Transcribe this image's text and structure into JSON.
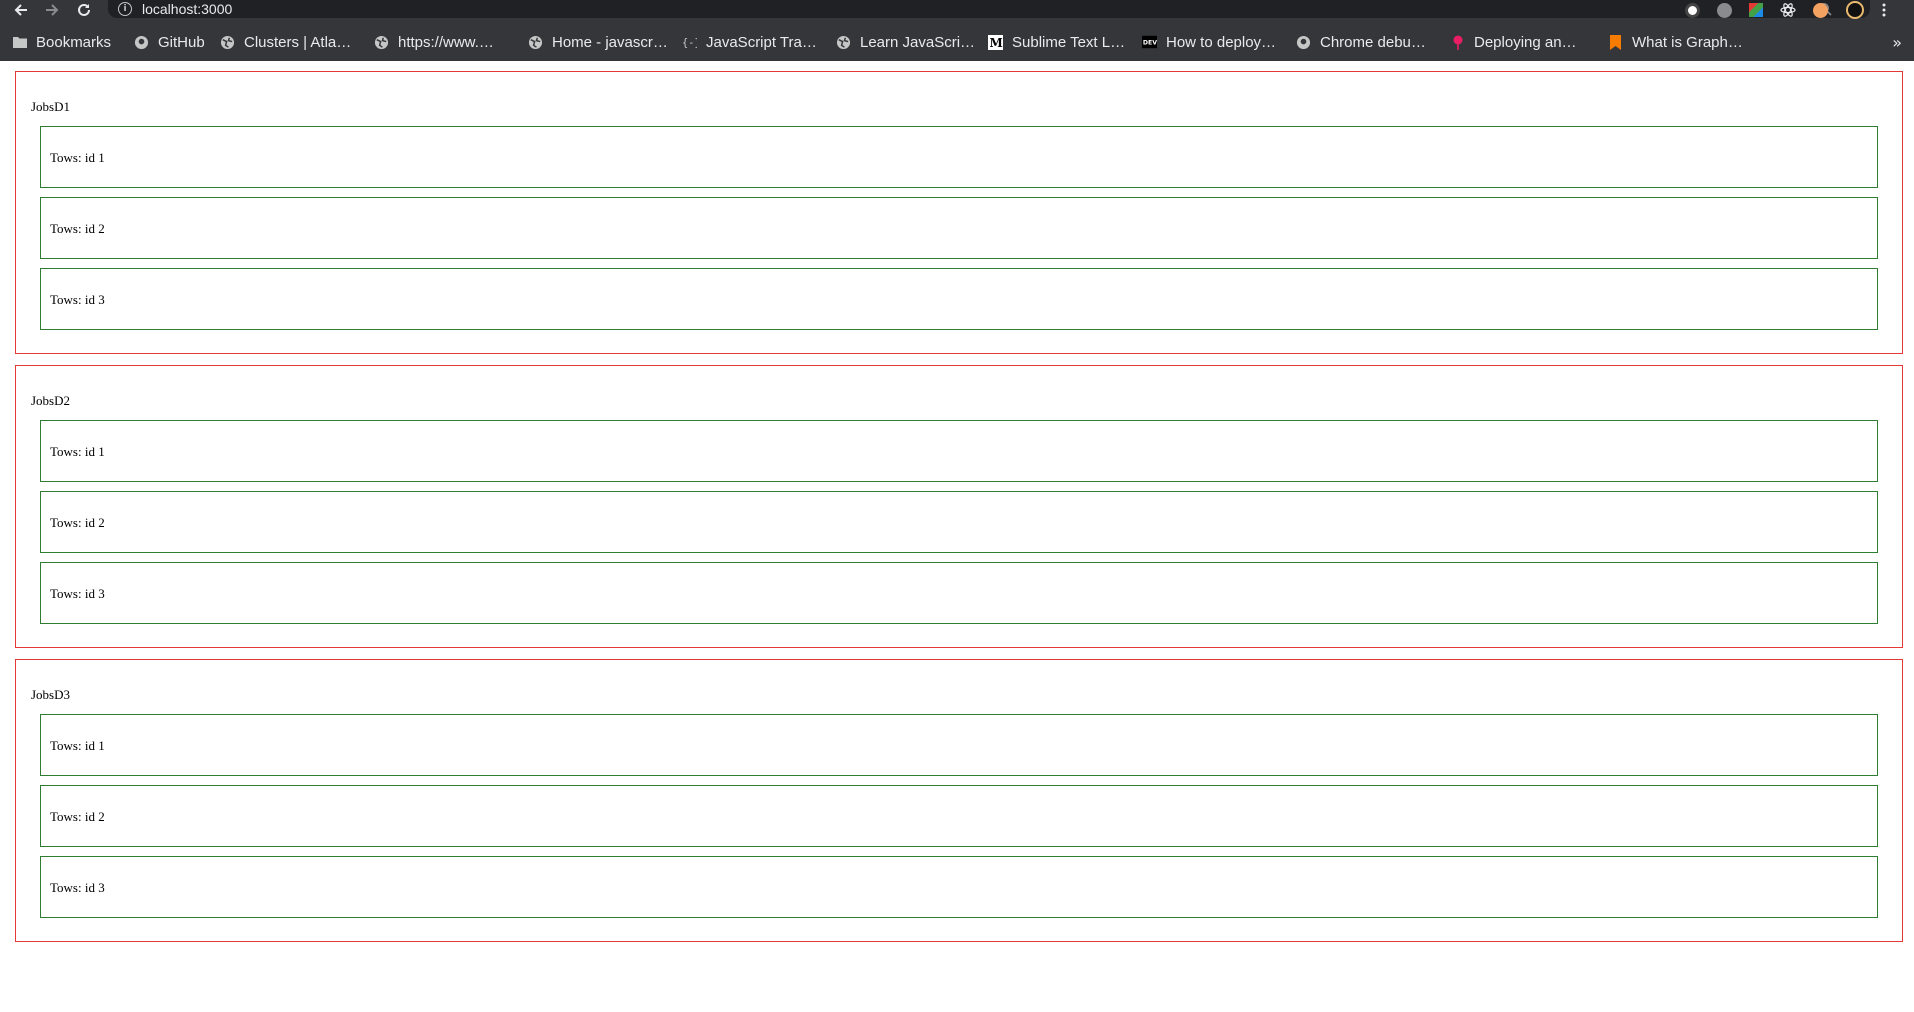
{
  "browser": {
    "url": "localhost:3000",
    "bookmarks": [
      {
        "label": "Bookmarks",
        "icon": "folder-icon"
      },
      {
        "label": "GitHub",
        "icon": "github-icon"
      },
      {
        "label": "Clusters | Atla…",
        "icon": "globe-icon"
      },
      {
        "label": "https://www.…",
        "icon": "globe-icon"
      },
      {
        "label": "Home - javascr…",
        "icon": "globe-icon"
      },
      {
        "label": "JavaScript Tra…",
        "icon": "braces-icon"
      },
      {
        "label": "Learn JavaScri…",
        "icon": "globe-icon"
      },
      {
        "label": "Sublime Text L…",
        "icon": "medium-icon"
      },
      {
        "label": "How to deploy…",
        "icon": "dev-icon"
      },
      {
        "label": "Chrome debu…",
        "icon": "github-icon"
      },
      {
        "label": "Deploying an…",
        "icon": "pin-icon"
      },
      {
        "label": "What is Graph…",
        "icon": "bookmark-icon"
      }
    ],
    "overflow": "»"
  },
  "jobs": [
    {
      "title": "JobsD1",
      "tows": [
        "Tows: id 1",
        "Tows: id 2",
        "Tows: id 3"
      ]
    },
    {
      "title": "JobsD2",
      "tows": [
        "Tows: id 1",
        "Tows: id 2",
        "Tows: id 3"
      ]
    },
    {
      "title": "JobsD3",
      "tows": [
        "Tows: id 1",
        "Tows: id 2",
        "Tows: id 3"
      ]
    }
  ],
  "colors": {
    "chrome_bg": "#35363a",
    "omnibox_bg": "#202124",
    "jobs_border": "#e53935",
    "tow_border": "#2e7d32"
  }
}
